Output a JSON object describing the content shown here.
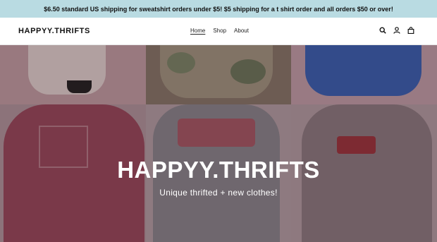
{
  "announcement": "$6.50 standard US shipping for sweatshirt orders under $5! $5 shipping for a t shirt order and all orders $50 or over!",
  "header": {
    "logo": "HAPPYY.THRIFTS",
    "nav": [
      {
        "label": "Home",
        "active": true
      },
      {
        "label": "Shop"
      },
      {
        "label": "About"
      }
    ],
    "icons": [
      "search-icon",
      "account-icon",
      "cart-icon"
    ]
  },
  "hero": {
    "title": "HAPPYY.THRIFTS",
    "subtitle": "Unique thrifted + new clothes!"
  },
  "colors": {
    "announcement_bg": "#b9dbe2",
    "sweatshirt_maroon": "#9b4a5e",
    "shirt_gray": "#8c8a90",
    "sweatshirt_blue": "#3a63b8"
  }
}
